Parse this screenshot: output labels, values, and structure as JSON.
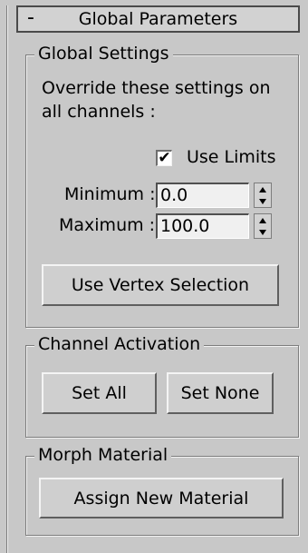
{
  "header": {
    "toggle": "-",
    "title": "Global Parameters"
  },
  "global_settings": {
    "legend": "Global Settings",
    "description_line1": "Override these settings on",
    "description_line2": "all channels :",
    "use_limits": {
      "label": "Use Limits",
      "checked": true,
      "mark": "✔"
    },
    "minimum": {
      "label": "Minimum :",
      "value": "0.0"
    },
    "maximum": {
      "label": "Maximum :",
      "value": "100.0"
    },
    "use_vertex_selection": "Use Vertex Selection"
  },
  "channel_activation": {
    "legend": "Channel Activation",
    "set_all": "Set All",
    "set_none": "Set None"
  },
  "morph_material": {
    "legend": "Morph Material",
    "assign_new_material": "Assign New Material"
  }
}
